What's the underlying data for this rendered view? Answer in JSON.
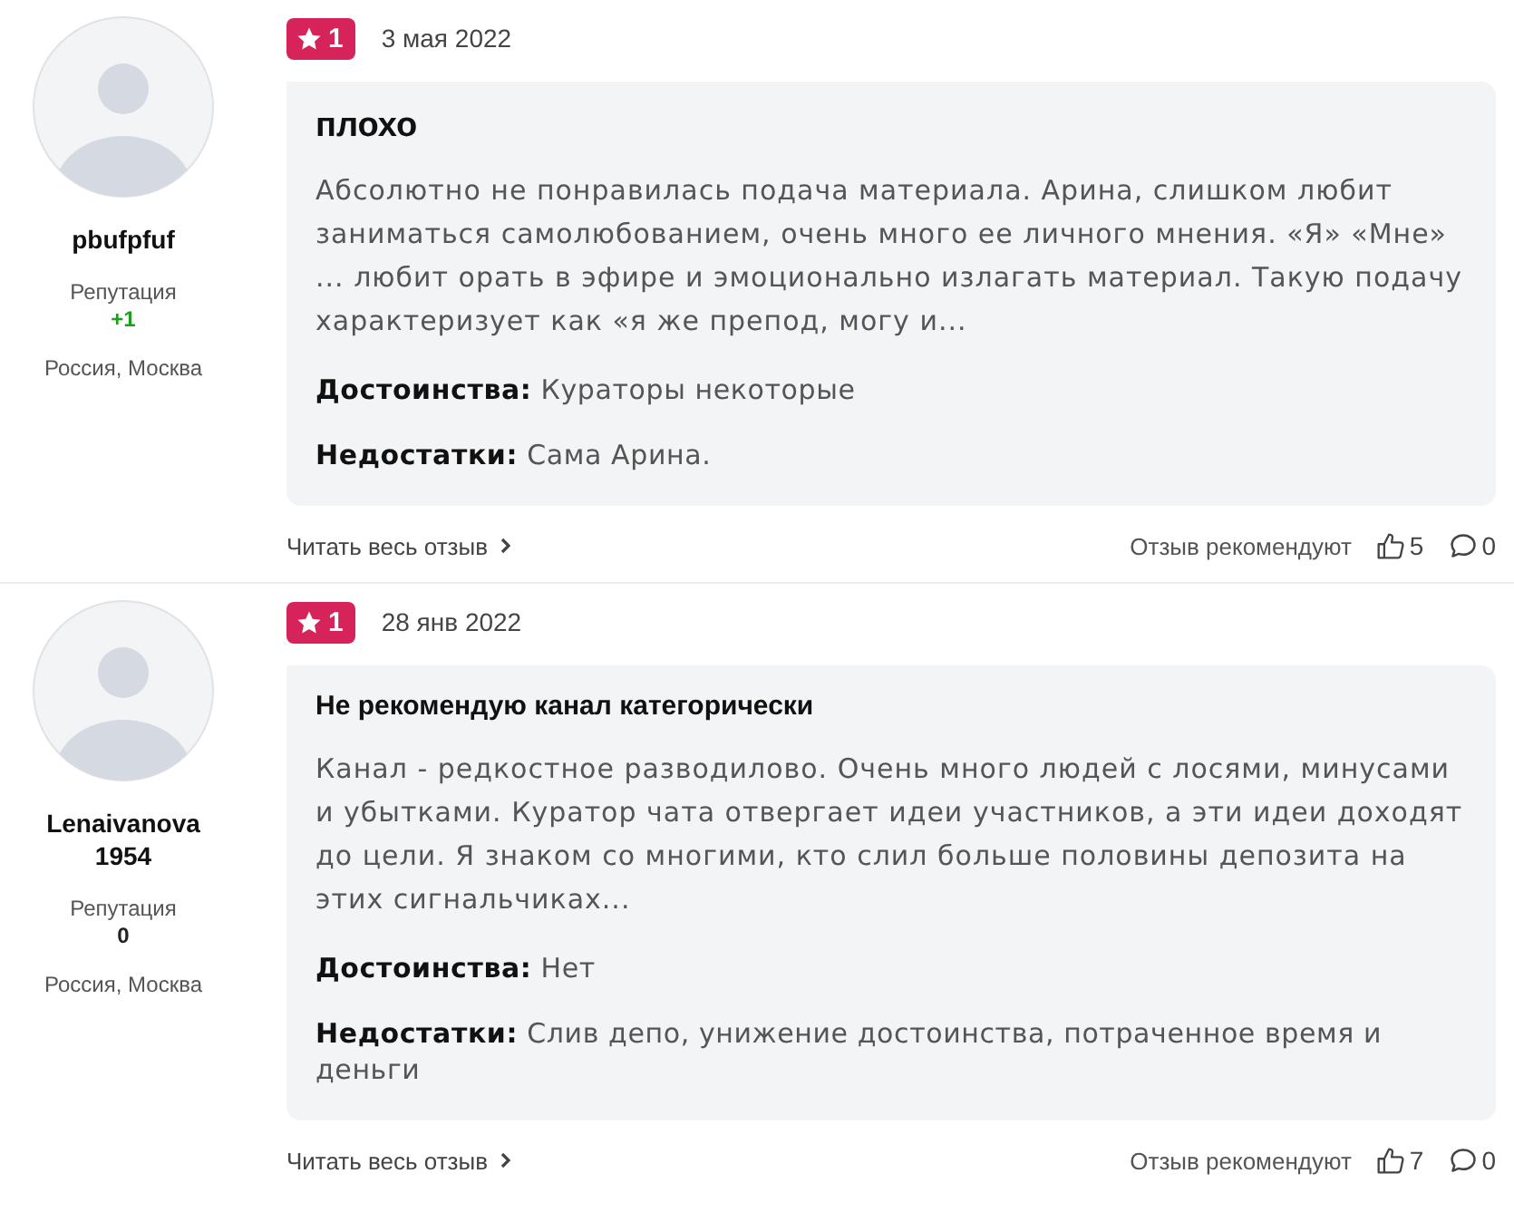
{
  "reviews": [
    {
      "author": {
        "name": "pbufpfuf",
        "reputation_label": "Репутация",
        "reputation": "+1",
        "color": "#1e9e1e",
        "location": "Россия, Москва"
      },
      "rating": "1",
      "date": "3 мая 2022",
      "title": "плохо",
      "kind": "large",
      "text": "Абсолютно не понравилась подача материала. Арина, слишком любит заниматься самолюбованием, очень много ее личного мнения. «Я» «Мне» ... любит орать в эфире и эмоционально излагать материал. Такую подачу характеризует как «я же препод, могу и...",
      "pros_label": "Достоинства:",
      "pros": "Кураторы некоторые",
      "cons_label": "Недостатки:",
      "cons": "Сама Арина.",
      "read_more": "Читать весь отзыв",
      "recommend_label": "Отзыв рекомендуют",
      "likes": "5",
      "comments": "0"
    },
    {
      "author": {
        "name": "Lenaivanova 1954",
        "reputation_label": "Репутация",
        "reputation": "0",
        "color": "#222222",
        "location": "Россия, Москва"
      },
      "rating": "1",
      "date": "28 янв 2022",
      "title": "Не рекомендую канал категорически",
      "kind": "normal",
      "text": "Канал - редкостное разводилово. Очень много людей с лосями, минусами и убытками. Куратор чата отвергает идеи участников, а эти идеи доходят до цели. Я знаком со многими, кто слил больше половины депозита на этих сигнальчиках...",
      "pros_label": "Достоинства:",
      "pros": "Нет",
      "cons_label": "Недостатки:",
      "cons": "Слив депо, унижение достоинства, потраченное время и деньги",
      "read_more": "Читать весь отзыв",
      "recommend_label": "Отзыв рекомендуют",
      "likes": "7",
      "comments": "0"
    }
  ]
}
